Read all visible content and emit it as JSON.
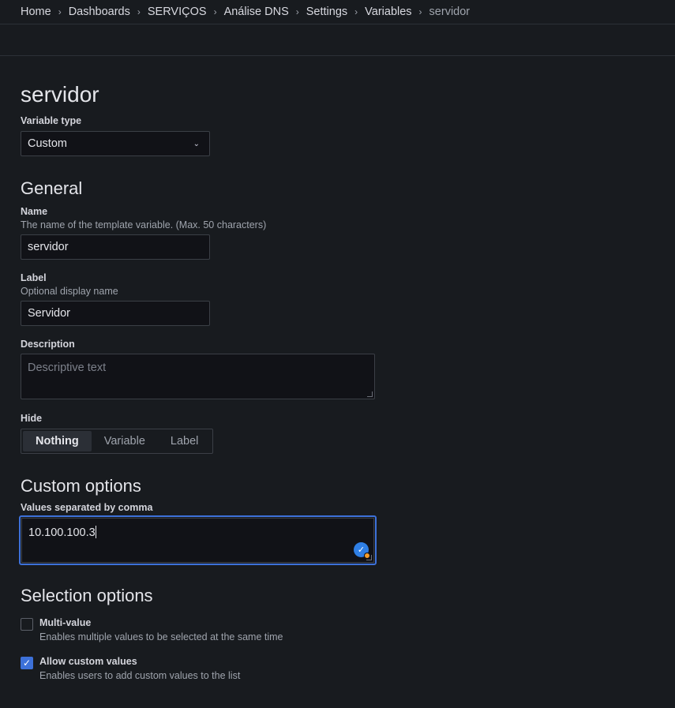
{
  "breadcrumb": [
    "Home",
    "Dashboards",
    "SERVIÇOS",
    "Análise DNS",
    "Settings",
    "Variables",
    "servidor"
  ],
  "page_title": "servidor",
  "variable_type": {
    "label": "Variable type",
    "value": "Custom"
  },
  "general": {
    "heading": "General",
    "name": {
      "label": "Name",
      "desc": "The name of the template variable. (Max. 50 characters)",
      "value": "servidor"
    },
    "label": {
      "label": "Label",
      "desc": "Optional display name",
      "value": "Servidor"
    },
    "description": {
      "label": "Description",
      "placeholder": "Descriptive text"
    },
    "hide": {
      "label": "Hide",
      "options": [
        "Nothing",
        "Variable",
        "Label"
      ],
      "selected": "Nothing"
    }
  },
  "custom_options": {
    "heading": "Custom options",
    "values_label": "Values separated by comma",
    "values": "10.100.100.3"
  },
  "selection_options": {
    "heading": "Selection options",
    "multi_value": {
      "label": "Multi-value",
      "desc": "Enables multiple values to be selected at the same time",
      "checked": false
    },
    "allow_custom": {
      "label": "Allow custom values",
      "desc": "Enables users to add custom values to the list",
      "checked": true
    }
  }
}
